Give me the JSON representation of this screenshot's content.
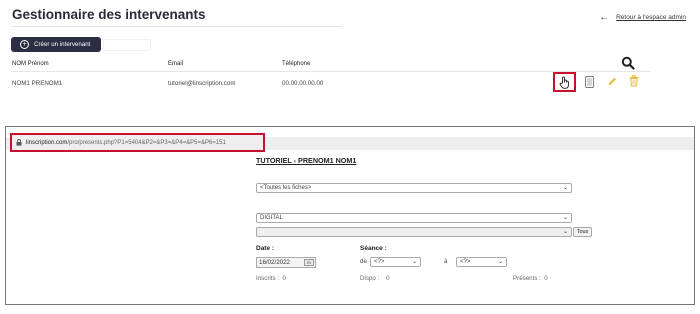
{
  "header": {
    "title": "Gestionnaire des intervenants",
    "back_link": "Retour à l'espace admin",
    "create_button": "Créer un intervenant"
  },
  "table": {
    "columns": [
      "NOM Prénom",
      "Email",
      "Téléphone"
    ],
    "rows": [
      {
        "name": "NOM1 PRENOM1",
        "email": "tutoriel@linscription.com",
        "phone": "00.00.00.00.00"
      }
    ]
  },
  "browser": {
    "url_domain": "linscription.com",
    "url_path": "/pro/presents.php?P1=5404&P2=&P3=&P4=&P5=&P6=151"
  },
  "sheet": {
    "title": "TUTORIEL - PRENOM1 NOM1",
    "fiches_select": "<Toutes les fiches>",
    "category_select": "DIGITAL",
    "second_select": "",
    "tous_button": "Tous",
    "date_label": "Date :",
    "date_value": "16/02/2022",
    "date_button": "m",
    "seance_label": "Séance :",
    "de_label": "de",
    "de_value": "<?>",
    "a_label": "à",
    "a_value": "<?>",
    "inscrits": "Inscrits :  0",
    "dispo": "Dispo :    0",
    "presents": "Présents :  0"
  },
  "colors": {
    "accent": "#2b2d42",
    "highlight": "#c8102e",
    "edit": "#e9b83a",
    "delete": "#e9b83a"
  }
}
